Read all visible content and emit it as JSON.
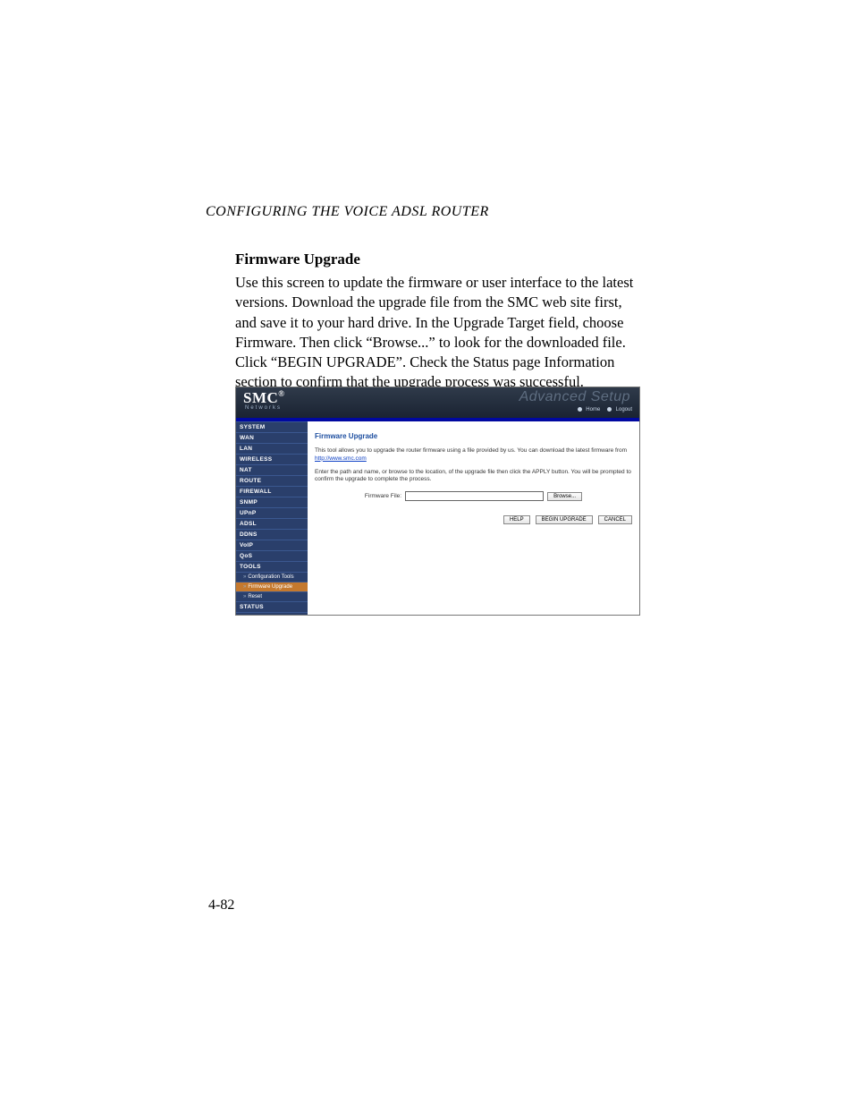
{
  "doc": {
    "running_head": "CONFIGURING THE VOICE ADSL ROUTER",
    "section_title": "Firmware Upgrade",
    "body": "Use this screen to update the firmware or user interface to the latest versions. Download the upgrade file from the SMC web site first, and save it to your hard drive. In the Upgrade Target field, choose Firmware. Then click “Browse...” to look for the downloaded file. Click “BEGIN UPGRADE”. Check the Status page Information section to confirm that the upgrade process was successful.",
    "page_num": "4-82"
  },
  "shot": {
    "brand": "SMC",
    "brand_sub": "Networks",
    "tagline": "Advanced Setup",
    "home": "Home",
    "logout": "Logout",
    "nav": {
      "system": "SYSTEM",
      "wan": "WAN",
      "lan": "LAN",
      "wireless": "WIRELESS",
      "nat": "NAT",
      "route": "ROUTE",
      "firewall": "FIREWALL",
      "snmp": "SNMP",
      "upnp": "UPnP",
      "adsl": "ADSL",
      "ddns": "DDNS",
      "voip": "VoIP",
      "qos": "QoS",
      "tools": "TOOLS",
      "sub_conf": "Configuration Tools",
      "sub_fw": "Firmware Upgrade",
      "sub_reset": "Reset",
      "status": "STATUS"
    },
    "content": {
      "title": "Firmware Upgrade",
      "p1a": "This tool allows you to upgrade the router firmware using a file provided by us. You can download the latest firmware from ",
      "p1_link": "http://www.smc.com",
      "p2": "Enter the path and name, or browse to the location, of the upgrade file then click the APPLY button. You will be prompted to confirm the upgrade to complete the process.",
      "file_label": "Firmware File:",
      "browse": "Browse...",
      "help": "HELP",
      "begin": "BEGIN UPGRADE",
      "cancel": "CANCEL"
    }
  }
}
